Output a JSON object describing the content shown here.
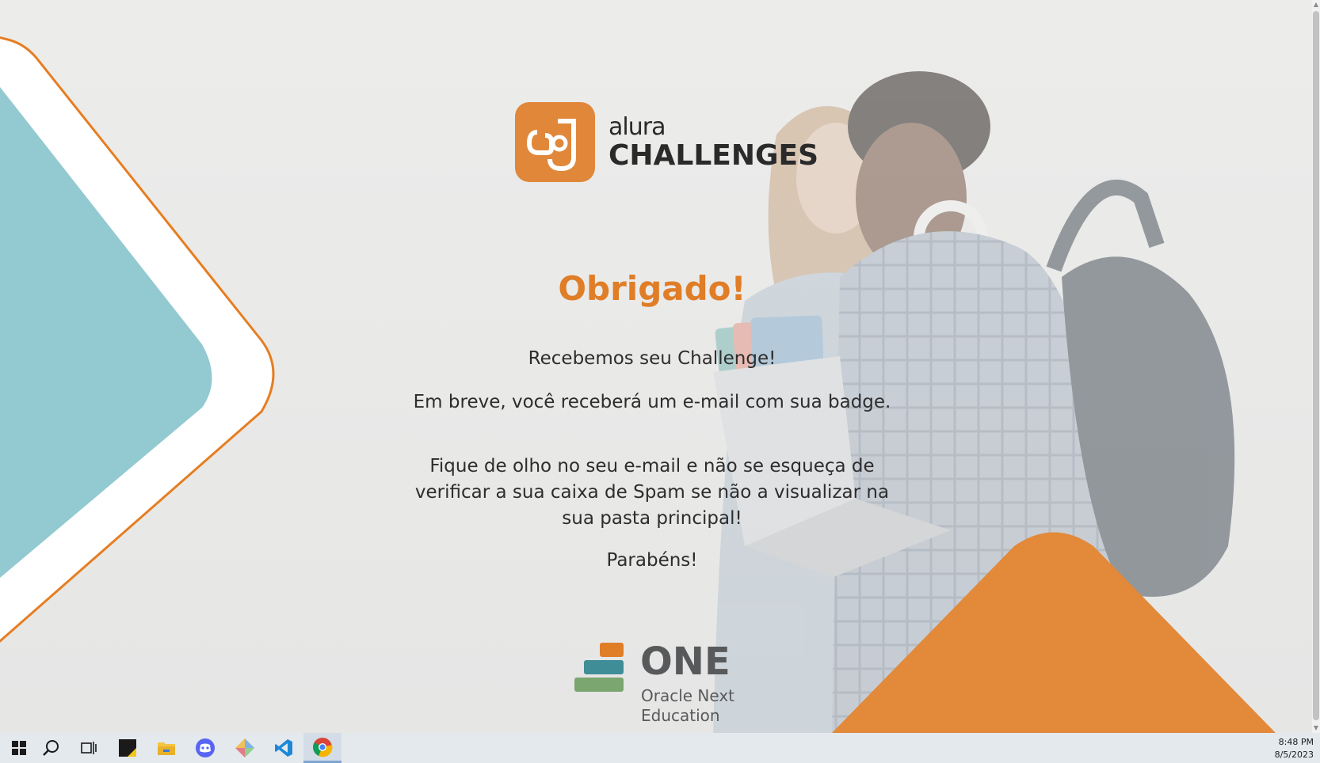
{
  "brand": {
    "small": "alura",
    "big": "CHALLENGES"
  },
  "message": {
    "title": "Obrigado!",
    "line1": "Recebemos seu Challenge!",
    "line2": "Em breve, você receberá um e-mail com sua badge.",
    "line3": "Fique de olho no seu e-mail e não se esqueça de verificar a sua caixa de Spam se não a visualizar na sua pasta principal!",
    "line4": "Parabéns!"
  },
  "footer_logo": {
    "word": "ONE",
    "sub1": "Oracle Next",
    "sub2": "Education"
  },
  "colors": {
    "accent": "#e0873a",
    "teal": "#93c9d1",
    "text": "#2d2d2d"
  },
  "taskbar": {
    "apps": [
      "windows-start-icon",
      "search-icon",
      "task-view-icon",
      "sticky-notes-icon",
      "file-explorer-icon",
      "discord-icon",
      "git-icon",
      "vscode-icon",
      "chrome-icon"
    ],
    "time": "8:48 PM",
    "date": "8/5/2023"
  }
}
